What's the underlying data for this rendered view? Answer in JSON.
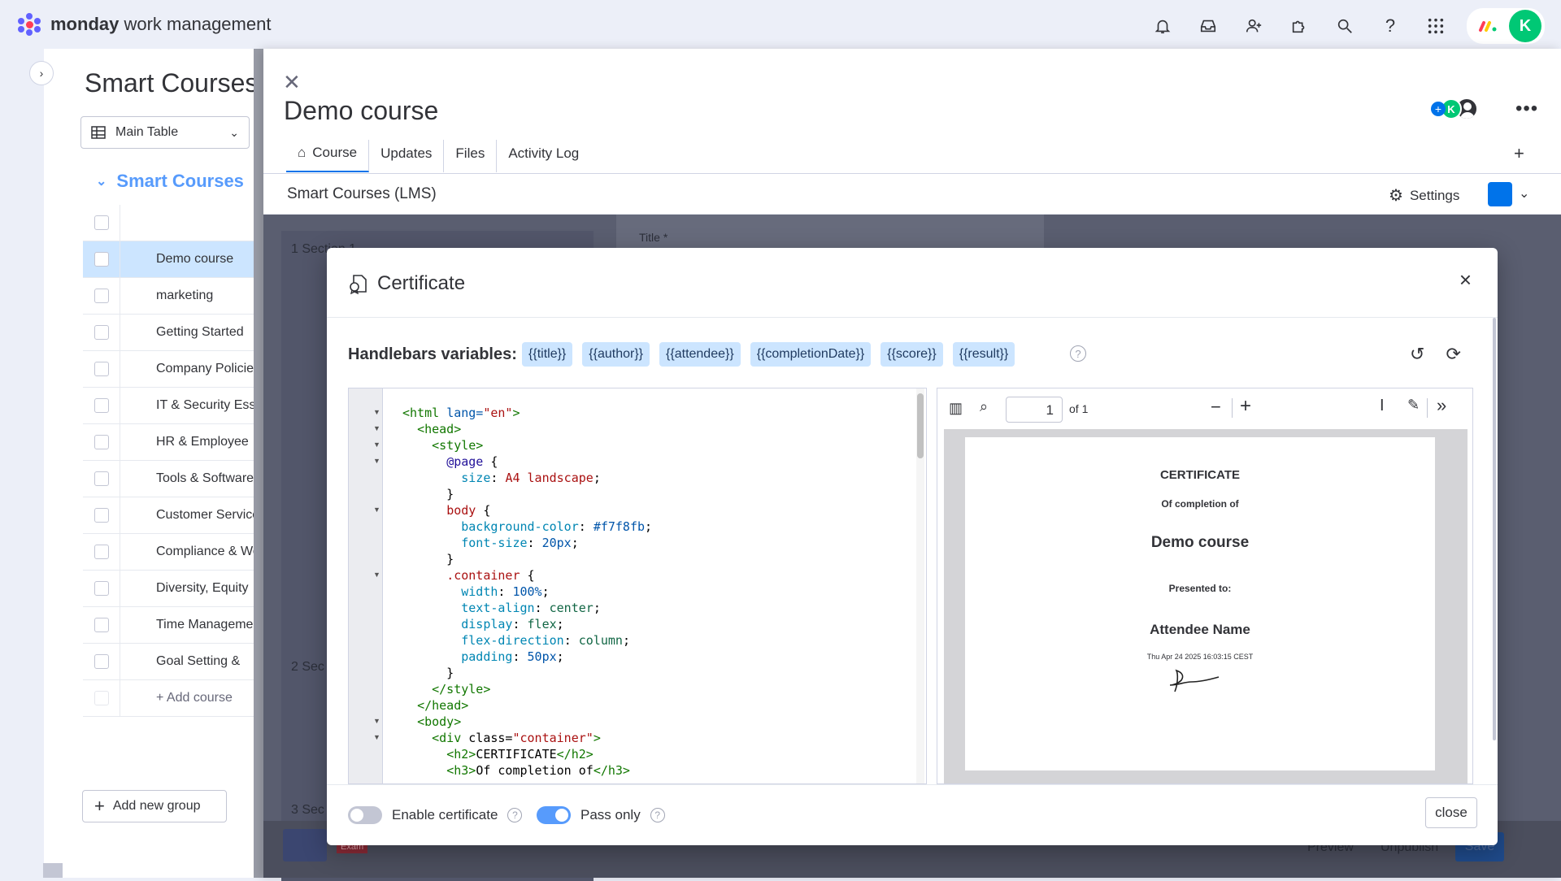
{
  "topbar": {
    "brand_strong": "monday",
    "brand_rest": " work management",
    "avatar_initial": "K"
  },
  "board": {
    "title": "Smart Courses (LMS)",
    "view_label": "Main Table",
    "group_title": "Smart Courses",
    "rows": [
      {
        "name": ""
      },
      {
        "name": "Demo course"
      },
      {
        "name": "marketing"
      },
      {
        "name": "Getting Started"
      },
      {
        "name": "Company Policies"
      },
      {
        "name": "IT & Security Essentials"
      },
      {
        "name": "HR & Employee"
      },
      {
        "name": "Tools & Software"
      },
      {
        "name": "Customer Service"
      },
      {
        "name": "Compliance & Work"
      },
      {
        "name": "Diversity, Equity"
      },
      {
        "name": "Time Management"
      },
      {
        "name": "Goal Setting &"
      }
    ],
    "add_course": "+ Add course",
    "add_group": "Add new group"
  },
  "item": {
    "title": "Demo course",
    "tabs": [
      "Course",
      "Updates",
      "Files",
      "Activity Log"
    ],
    "app_name": "Smart Courses (LMS)",
    "settings_label": "Settings",
    "people_initial": "K"
  },
  "background": {
    "section1": "1  Section 1",
    "section2": "2  Sec",
    "section3": "3  Sec",
    "title_field": "Title *",
    "exam": "Exam",
    "preview": "Preview",
    "unpublish": "Unpublish",
    "save": "Save"
  },
  "modal": {
    "title": "Certificate",
    "handlebars_label": "Handlebars variables:",
    "vars": [
      "{{title}}",
      "{{author}}",
      "{{attendee}}",
      "{{completionDate}}",
      "{{score}}",
      "{{result}}"
    ],
    "pdf_page": "1",
    "pdf_of": "of 1",
    "certificate": {
      "heading": "CERTIFICATE",
      "sub": "Of completion of",
      "course": "Demo course",
      "presented": "Presented to:",
      "attendee": "Attendee Name",
      "date": "Thu Apr 24 2025 16:03:15 CEST"
    },
    "enable_label": "Enable certificate",
    "enable_on": false,
    "pass_label": "Pass only",
    "pass_on": true,
    "close_label": "close"
  },
  "colors": {
    "accent": "#0073ea",
    "group": "#579bfc",
    "chip": "#cce5ff",
    "toggle_on": "#579bfc",
    "toggle_off": "#c3c6d4"
  }
}
